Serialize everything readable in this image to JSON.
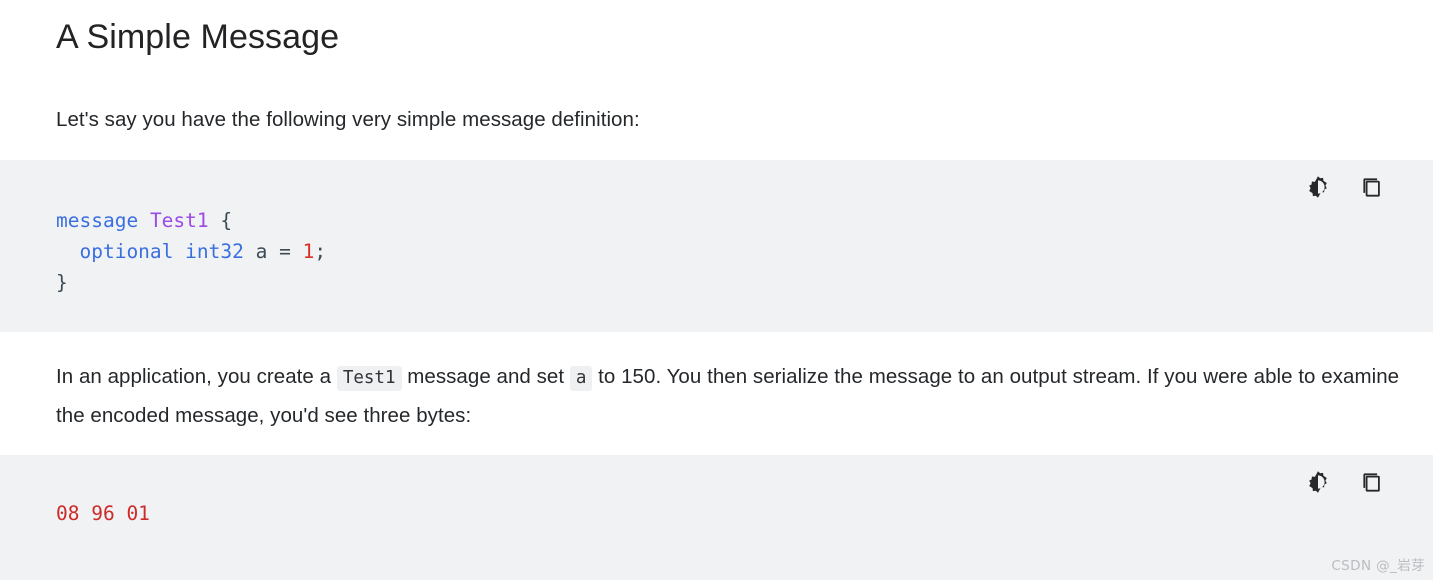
{
  "article": {
    "title": "A Simple Message",
    "intro_paragraph": "Let's say you have the following very simple message definition:",
    "mid_paragraph": {
      "part1": "In an application, you create a ",
      "code1": "Test1",
      "part2": " message and set ",
      "code2": "a",
      "part3": " to 150. You then serialize the message to an output stream. If you were able to examine the encoded message, you'd see three bytes:"
    }
  },
  "code_blocks": [
    {
      "name": "proto-definition",
      "language": "protobuf",
      "lines": [
        {
          "tokens": [
            {
              "text": "message",
              "type": "keyword"
            },
            {
              "text": " ",
              "type": "plain"
            },
            {
              "text": "Test1",
              "type": "class"
            },
            {
              "text": " {",
              "type": "plain"
            }
          ]
        },
        {
          "tokens": [
            {
              "text": "  ",
              "type": "plain"
            },
            {
              "text": "optional",
              "type": "keyword"
            },
            {
              "text": " ",
              "type": "plain"
            },
            {
              "text": "int32",
              "type": "type"
            },
            {
              "text": " a = ",
              "type": "plain"
            },
            {
              "text": "1",
              "type": "number"
            },
            {
              "text": ";",
              "type": "plain"
            }
          ]
        },
        {
          "tokens": [
            {
              "text": "}",
              "type": "plain"
            }
          ]
        }
      ],
      "toolbar": {
        "brightness_label": "Toggle code theme",
        "copy_label": "Copy code"
      }
    },
    {
      "name": "encoded-bytes",
      "language": "hex",
      "lines": [
        {
          "tokens": [
            {
              "text": "08 96 01",
              "type": "hex"
            }
          ]
        }
      ],
      "toolbar": {
        "brightness_label": "Toggle code theme",
        "copy_label": "Copy code"
      }
    }
  ],
  "watermark": "CSDN @_岩芽",
  "colors": {
    "page_background": "#ffffff",
    "code_background": "#f1f2f4",
    "inline_code_background": "#eef0f2",
    "keyword": "#3b6fe0",
    "class_name": "#9b4ae3",
    "number": "#d93025",
    "hex_bytes": "#cc2b28",
    "body_text": "#25282b",
    "watermark": "#b9bcc0"
  }
}
